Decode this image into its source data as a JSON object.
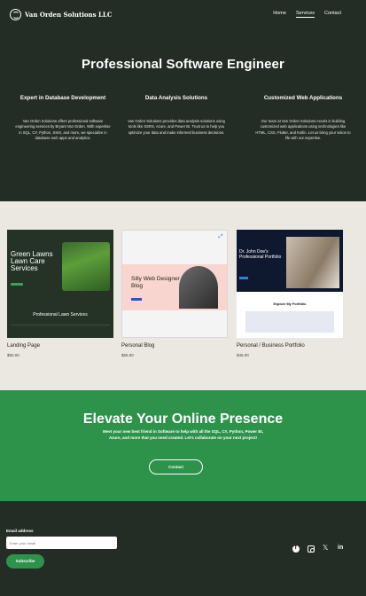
{
  "header": {
    "brand": "Van Orden Solutions LLC",
    "nav": [
      "Home",
      "Services",
      "Contact"
    ],
    "active_nav": "Services"
  },
  "hero": {
    "title": "Professional Software Engineer",
    "columns": [
      {
        "heading": "Expert in Database Development",
        "text": "Van Orden Solutions offers professional software engineering services by Bryant Van Orden. With expertise in SQL, C#, Python, SSIS, and more, we specialize in database web apps and analytics."
      },
      {
        "heading": "Data Analysis Solutions",
        "text": "Van Orden Solutions provides data analysis solutions using tools like SSRS, Azure, and Power BI. Trust us to help you optimize your data and make informed business decisions."
      },
      {
        "heading": "Customized Web Applications",
        "text": "Our team at Van Orden Solutions excels in building customized web applications using technologies like HTML, CSS, Flutter, and Kotlin. Let us bring your vision to life with our expertise."
      }
    ]
  },
  "portfolio": {
    "items": [
      {
        "title": "Landing Page",
        "price": "$50.00",
        "thumb_title": "Green Lawns Lawn Care Services",
        "thumb_caption": "Professional Lawn Services"
      },
      {
        "title": "Personal Blog",
        "price": "$65.00",
        "thumb_title": "Silly Web Designer Blog"
      },
      {
        "title": "Personal / Business Portfolio",
        "price": "$45.00",
        "thumb_title": "Dr. John Doe's Professional Portfolio",
        "thumb_caption": "Explore My Portfolio"
      }
    ]
  },
  "cta": {
    "title": "Elevate Your Online Presence",
    "text": "Meet your new best friend in Software to help with all the SQL, C#, Python, Power BI, Azure, and more that you need created. Let's collaborate on your next project!",
    "button": "Contact"
  },
  "footer": {
    "email_label": "Email address",
    "email_placeholder": "Enter your email",
    "subscribe": "Subscribe",
    "socials": [
      "facebook-icon",
      "instagram-icon",
      "x-icon",
      "linkedin-icon"
    ]
  },
  "colors": {
    "dark_bg": "#242c26",
    "light_bg": "#eae8e0",
    "green": "#2d934b"
  }
}
